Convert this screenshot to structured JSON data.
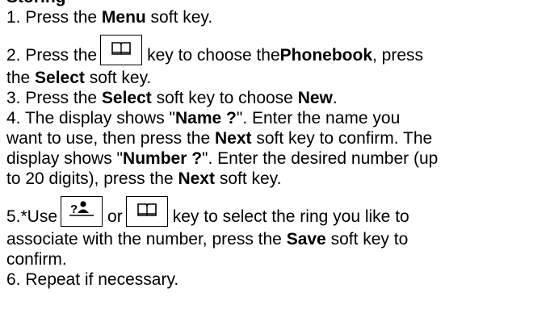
{
  "heading_fragment": "Storing",
  "steps": {
    "s1": {
      "a": "1. Press the ",
      "b": "Menu",
      "c": " soft key."
    },
    "s2": {
      "a": "2. Press the",
      "b": "key to choose the ",
      "c": "Phonebook",
      "d": ", press",
      "e": "the ",
      "f": "Select",
      "g": " soft key."
    },
    "s3": {
      "a": "3. Press the ",
      "b": "Select",
      "c": " soft key to choose ",
      "d": "New",
      "e": "."
    },
    "s4": {
      "l1a": "4. The display shows \"",
      "l1b": "Name ?",
      "l1c": "\". Enter the name you",
      "l2": "want to use, then press the ",
      "l2b": "Next",
      "l2c": " soft key to confirm. The",
      "l3a": "display shows \"",
      "l3b": "Number ?",
      "l3c": "\". Enter the desired number (up",
      "l4a": "to 20 digits), press the ",
      "l4b": "Next",
      "l4c": " soft key."
    },
    "s5": {
      "a": "5.*Use",
      "or": "or",
      "b": "key to select the ring you like to",
      "c": "associate with the number, press the ",
      "d": "Save",
      "e": " soft key to",
      "f": "confirm."
    },
    "s6": {
      "a": "6. Repeat if necessary."
    }
  },
  "icons": {
    "phonebook_key": "phonebook-book-icon",
    "ring_key": "question-person-icon"
  }
}
